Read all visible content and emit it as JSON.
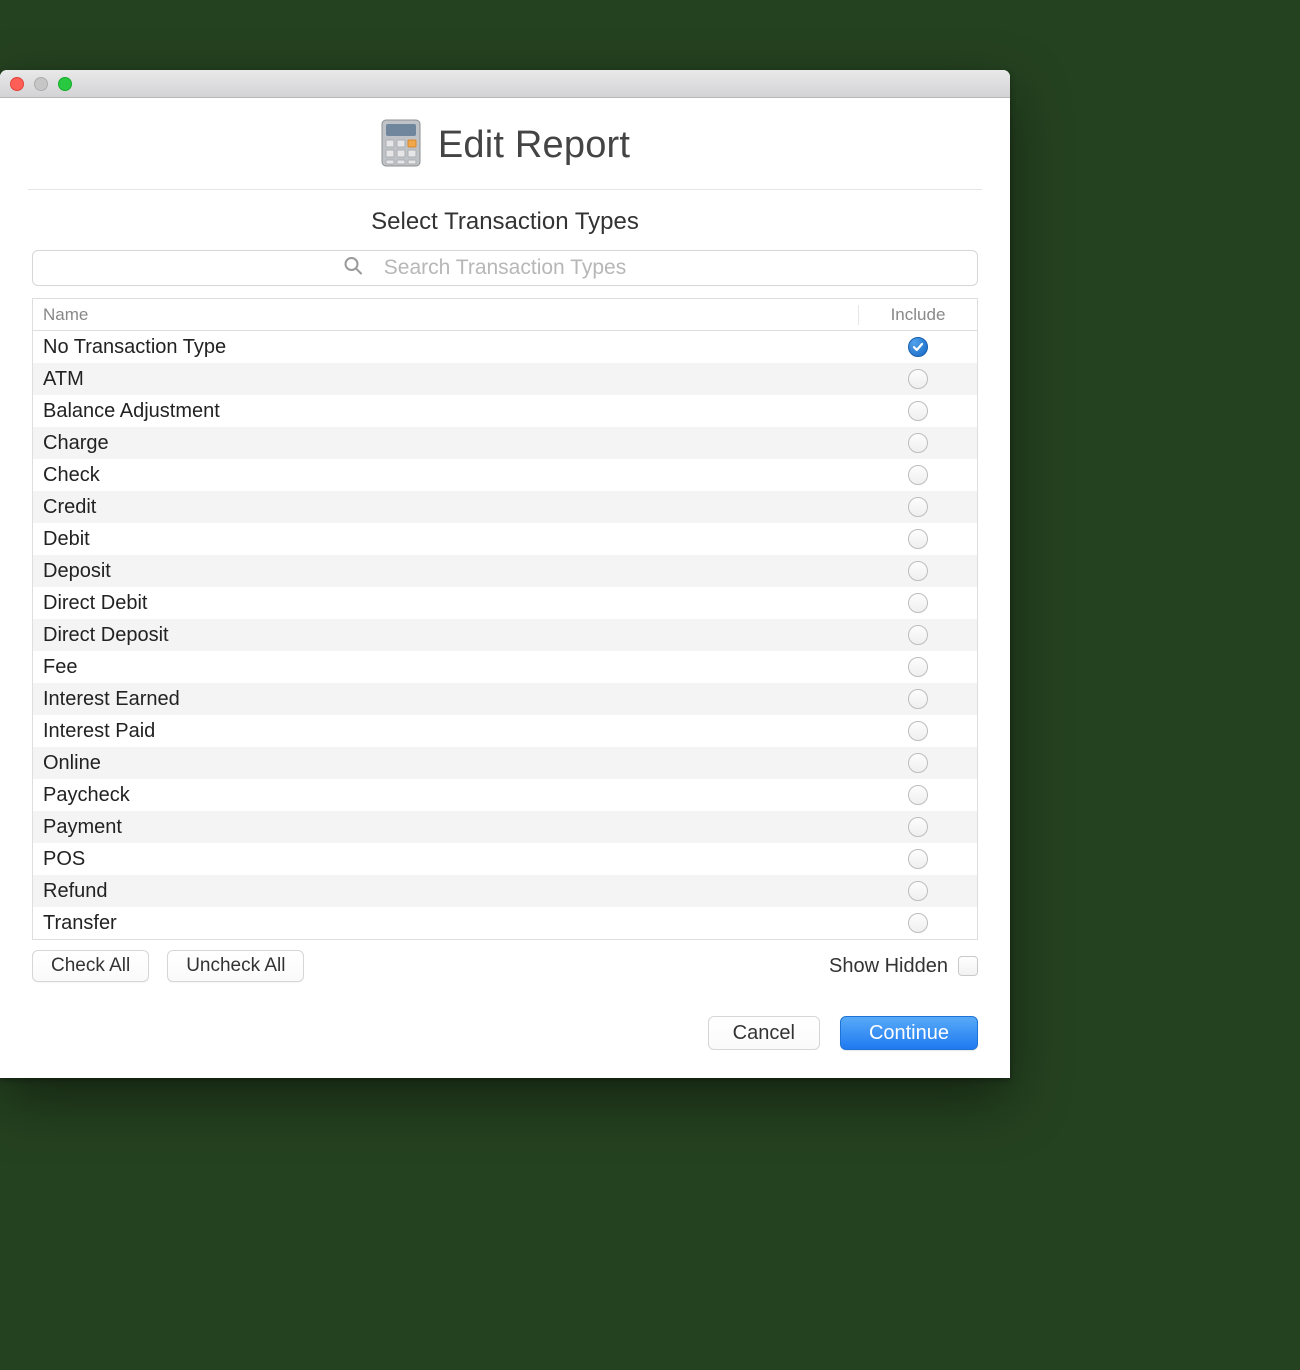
{
  "header": {
    "title": "Edit Report"
  },
  "subtitle": "Select Transaction Types",
  "search": {
    "placeholder": "Search Transaction Types",
    "value": ""
  },
  "columns": {
    "name": "Name",
    "include": "Include"
  },
  "rows": [
    {
      "name": "No Transaction Type",
      "included": true
    },
    {
      "name": "ATM",
      "included": false
    },
    {
      "name": "Balance Adjustment",
      "included": false
    },
    {
      "name": "Charge",
      "included": false
    },
    {
      "name": "Check",
      "included": false
    },
    {
      "name": "Credit",
      "included": false
    },
    {
      "name": "Debit",
      "included": false
    },
    {
      "name": "Deposit",
      "included": false
    },
    {
      "name": "Direct Debit",
      "included": false
    },
    {
      "name": "Direct Deposit",
      "included": false
    },
    {
      "name": "Fee",
      "included": false
    },
    {
      "name": "Interest Earned",
      "included": false
    },
    {
      "name": "Interest Paid",
      "included": false
    },
    {
      "name": "Online",
      "included": false
    },
    {
      "name": "Paycheck",
      "included": false
    },
    {
      "name": "Payment",
      "included": false
    },
    {
      "name": "POS",
      "included": false
    },
    {
      "name": "Refund",
      "included": false
    },
    {
      "name": "Transfer",
      "included": false
    }
  ],
  "buttons": {
    "check_all": "Check All",
    "uncheck_all": "Uncheck All",
    "show_hidden": "Show Hidden",
    "cancel": "Cancel",
    "continue": "Continue"
  },
  "show_hidden_checked": false
}
